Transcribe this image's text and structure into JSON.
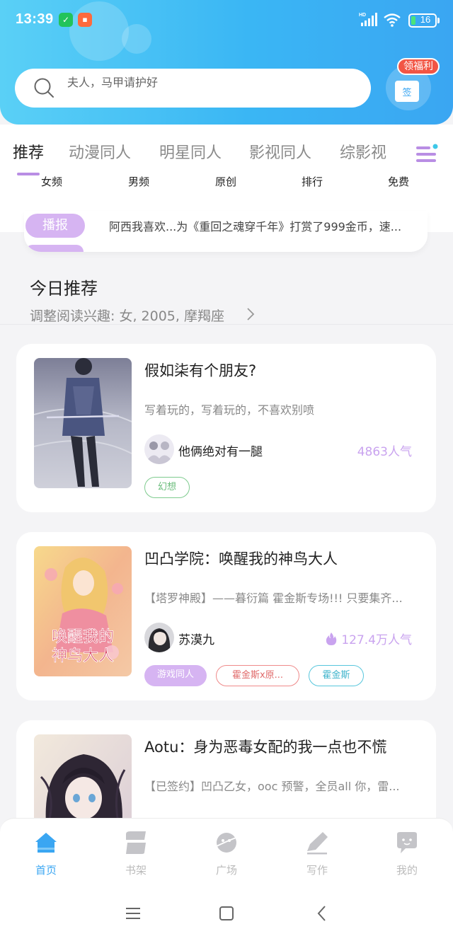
{
  "status_bar": {
    "time": "13:39",
    "battery": "16",
    "network_badge": "HD",
    "app_icons": [
      "security-app-icon",
      "shopping-app-icon"
    ],
    "colors": {
      "shield_app": "#22c35a",
      "shop_app": "#ff6a3d",
      "battery_fill": "#4be37a"
    }
  },
  "header": {
    "search_placeholder": "夫人，马甲请护好",
    "gift_badge": "领福利",
    "gift_box_label": "签",
    "colors": {
      "gradient_start": "#5ad0f6",
      "gradient_end": "#3aa6f2",
      "badge": "#f25544"
    }
  },
  "category_tabs": [
    {
      "label": "推荐",
      "active": true
    },
    {
      "label": "动漫同人",
      "active": false
    },
    {
      "label": "明星同人",
      "active": false
    },
    {
      "label": "影视同人",
      "active": false
    },
    {
      "label": "综影视",
      "active": false
    }
  ],
  "sub_tabs": [
    "女频",
    "男频",
    "原创",
    "排行",
    "免费"
  ],
  "broadcast": {
    "label": "播报",
    "text": "阿西我喜欢...为《重回之魂穿千年》打赏了999金币，速..."
  },
  "today": {
    "title": "今日推荐",
    "interest": "调整阅读兴趣: 女, 2005, 摩羯座"
  },
  "books": [
    {
      "title": "假如柒有个朋友?",
      "desc": "写着玩的，写着玩的，不喜欢别喷",
      "author": "他俩绝对有一腿",
      "popularity": "4863人气",
      "hot": false,
      "tags": [
        {
          "label": "幻想",
          "style": "green"
        }
      ]
    },
    {
      "title": "凹凸学院：唤醒我的神鸟大人",
      "desc": "【塔罗神殿】——暮衍篇 霍金斯专场!!! 只要集齐...",
      "author": "苏漠九",
      "popularity": "127.4万人气",
      "hot": true,
      "tags": [
        {
          "label": "游戏同人",
          "style": "purple-filled"
        },
        {
          "label": "霍金斯x原...",
          "style": "red"
        },
        {
          "label": "霍金斯",
          "style": "cyan"
        }
      ],
      "cover_text": "唤醒我的神鸟大人"
    },
    {
      "title": "Aotu：身为恶毒女配的我一点也不慌",
      "desc": "【已签约】凹凸乙女，ooc 预警，全员all 你，雷...",
      "author": "",
      "popularity": "",
      "hot": false,
      "tags": []
    }
  ],
  "bottom_nav": [
    {
      "label": "首页",
      "icon": "home-icon",
      "active": true
    },
    {
      "label": "书架",
      "icon": "bookshelf-icon",
      "active": false
    },
    {
      "label": "广场",
      "icon": "planet-icon",
      "active": false
    },
    {
      "label": "写作",
      "icon": "pen-icon",
      "active": false
    },
    {
      "label": "我的",
      "icon": "chat-bubble-icon",
      "active": false
    }
  ],
  "system_nav": [
    "menu-icon",
    "home-square-icon",
    "back-icon"
  ],
  "theme": {
    "accent": "#3aa6f2",
    "purple": "#c9a3ef",
    "tag_purple": "#d6b4f2"
  }
}
